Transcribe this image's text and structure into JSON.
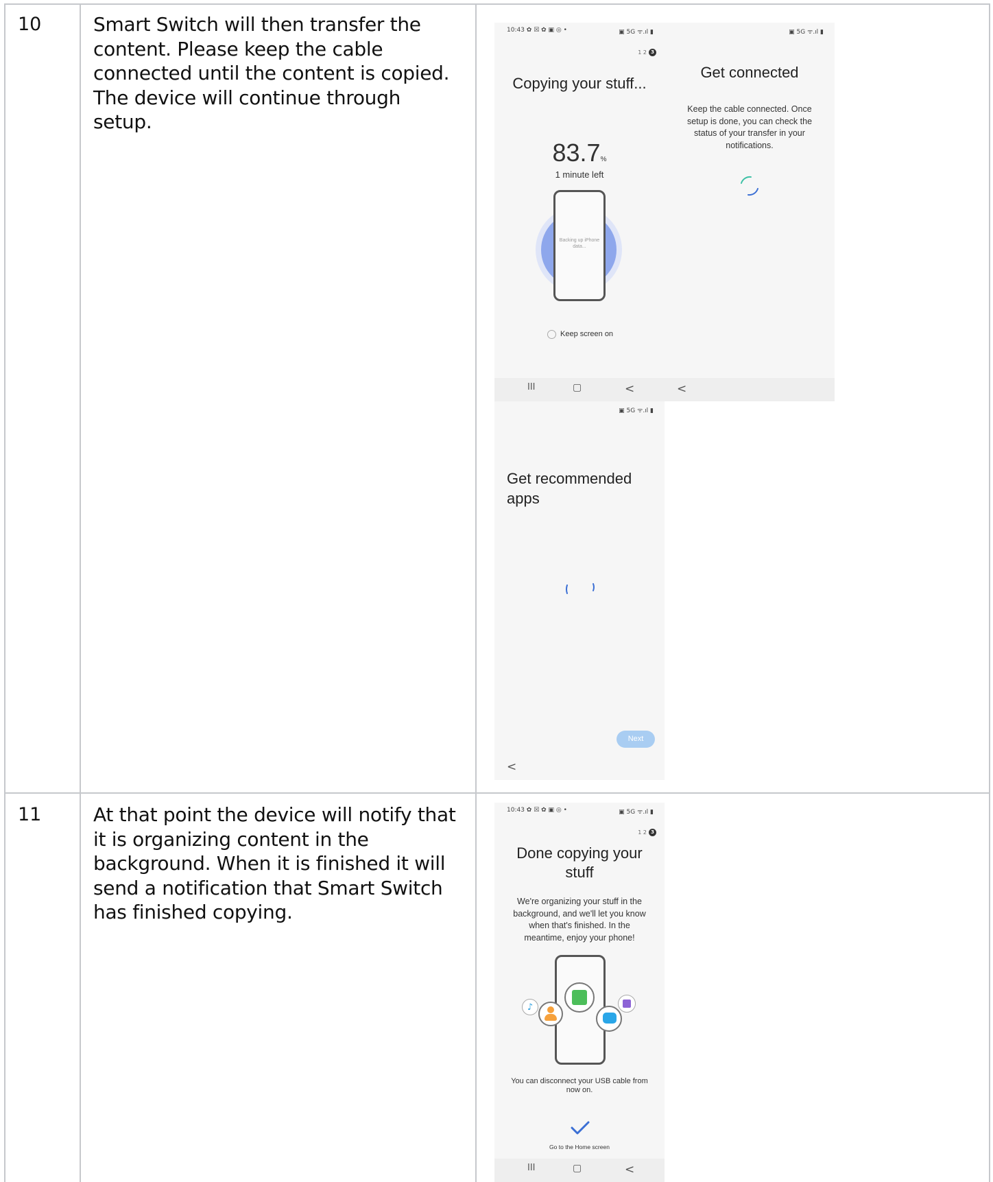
{
  "rows": [
    {
      "number": "10",
      "description": "Smart Switch will then transfer the content. Please keep the cable connected until the content is copied. The device will continue through setup."
    },
    {
      "number": "11",
      "description": "At that point the device will notify that it is organizing content in the background. When it is finished it will send a notification that Smart Switch has finished copying."
    }
  ],
  "screens": {
    "copying": {
      "status_time": "10:43 ✿ ☒ ✿ ▣ ◎ •",
      "status_right": "▣ 5G ᯤ.ıl ▮",
      "steps": "1  2",
      "step_active": "3",
      "title": "Copying your stuff...",
      "percent": "83.7",
      "percent_unit": "%",
      "progress": 0.837,
      "time_left": "1 minute left",
      "phone_text": "Backing up iPhone data...",
      "keep_screen": "Keep screen on"
    },
    "get_connected": {
      "status_right": "▣ 5G ᯤ.ıl ▮",
      "title": "Get connected",
      "text": "Keep the cable connected. Once setup is done, you can check the status of your transfer in your notifications."
    },
    "recommended": {
      "status_right": "▣ 5G ᯤ.ıl ▮",
      "title": "Get recommended apps",
      "next_label": "Next"
    },
    "done": {
      "status_time": "10:43 ✿ ☒ ✿ ▣ ◎ •",
      "status_right": "▣ 5G ᯤ.ıl ▮",
      "steps": "1  2",
      "step_active": "3",
      "title": "Done copying your stuff",
      "text": "We're organizing your stuff in the background, and we'll let you know when that's finished. In the meantime, enjoy your phone!",
      "usb_text": "You can disconnect your USB cable from now on.",
      "home_label": "Go to the Home screen"
    }
  },
  "navbar": {
    "recents": "III",
    "home": "▢",
    "back": "<"
  },
  "colors": {
    "accent_blue": "#3b6fd4",
    "ring_blue": "#8ea7ec",
    "next_button": "#a9cdf2",
    "border": "#c6c8cc"
  }
}
